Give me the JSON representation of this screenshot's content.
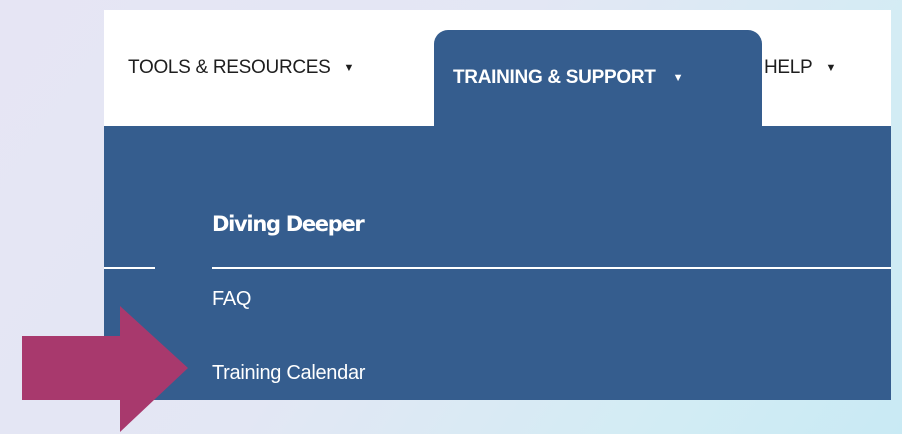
{
  "nav": {
    "items": [
      {
        "label": "TOOLS & RESOURCES",
        "caret": "▼"
      },
      {
        "label": "TRAINING & SUPPORT",
        "caret": "▼"
      },
      {
        "label": "HELP",
        "caret": "▼"
      }
    ],
    "active_index": 1
  },
  "dropdown": {
    "heading": "Diving Deeper",
    "links": [
      {
        "label": "FAQ"
      },
      {
        "label": "Training Calendar"
      }
    ]
  },
  "annotation": {
    "arrow_color": "#a8396d",
    "points_to": "Training Calendar"
  },
  "colors": {
    "menu_blue": "#355d8e",
    "nav_background": "#ffffff"
  }
}
